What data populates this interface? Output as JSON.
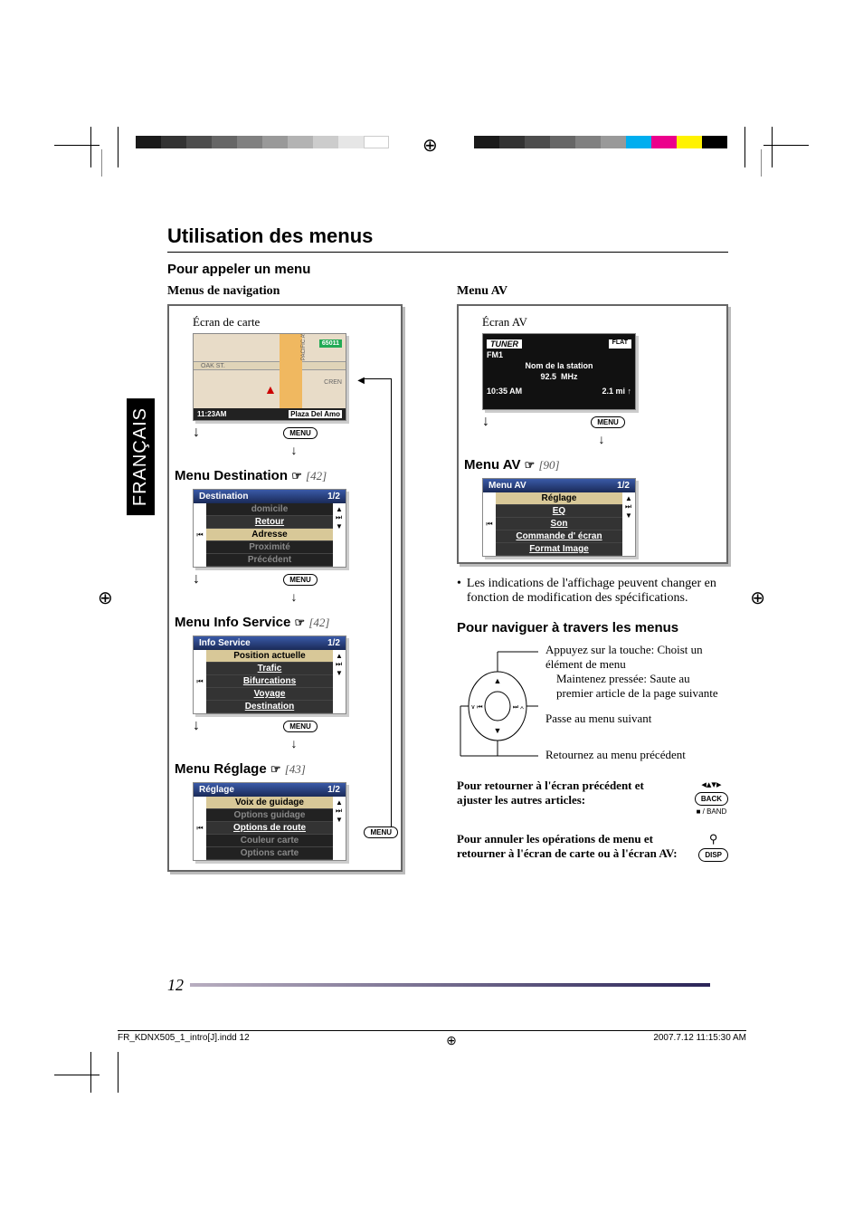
{
  "crop": {
    "grays": [
      "#1a1a1a",
      "#333",
      "#4d4d4d",
      "#666",
      "#808080",
      "#999",
      "#b3b3b3",
      "#ccc",
      "#e6e6e6",
      "#fff"
    ],
    "cmyk": [
      "#00aeef",
      "#ec008c",
      "#fff200",
      "#000"
    ],
    "reg": "⊕"
  },
  "sideTab": "FRANÇAIS",
  "title": "Utilisation des menus",
  "subtitle": "Pour appeler un menu",
  "left": {
    "navMenus": "Menus de navigation",
    "mapScreen": "Écran de carte",
    "map": {
      "streets": [
        "OAK ST.",
        "CREN",
        "PACIFIC AVE",
        "65011"
      ],
      "time": "11:23AM",
      "route": "▲",
      "place": "Plaza Del Amo"
    },
    "menuBtn": "MENU",
    "destTitle": "Menu Destination",
    "destRef": "[42]",
    "destMenu": {
      "header": "Destination",
      "page": "1/2",
      "items": [
        "domicile",
        "Retour",
        "Adresse",
        "Proximité",
        "Précédent"
      ],
      "selected": 2
    },
    "infoTitle": "Menu Info Service",
    "infoRef": "[42]",
    "infoMenu": {
      "header": "Info Service",
      "page": "1/2",
      "items": [
        "Position actuelle",
        "Trafic",
        "Bifurcations",
        "Voyage",
        "Destination"
      ],
      "selected": 0
    },
    "setTitle": "Menu Réglage",
    "setRef": "[43]",
    "setMenu": {
      "header": "Réglage",
      "page": "1/2",
      "items": [
        "Voix de guidage",
        "Options guidage",
        "Options de route",
        "Couleur carte",
        "Options carte"
      ],
      "selected": 0
    }
  },
  "right": {
    "avMenu": "Menu AV",
    "avScreen": "Écran AV",
    "av": {
      "tuner": "TUNER",
      "flat": "FLAT",
      "band": "FM1",
      "station": "Nom de la station",
      "freq": "92.5",
      "unit": "MHz",
      "time": "10:35 AM",
      "dist": "2.1 mi",
      "compass": "↑"
    },
    "avMenuTitle": "Menu AV",
    "avMenuRef": "[90]",
    "avMenuData": {
      "header": "Menu AV",
      "page": "1/2",
      "items": [
        "Réglage",
        "EQ",
        "Son",
        "Commande d' écran",
        "Format Image"
      ],
      "selected": 0
    },
    "bullet": "Les indications de l'affichage peuvent changer en fonction de modification des spécifications.",
    "navHeading": "Pour naviguer à travers les menus",
    "dpad": {
      "up": "Appuyez sur la touche: Choist un élément de menu",
      "hold": "Maintenez pressée: Saute au premier article de la page suivante",
      "right": "Passe au menu suivant",
      "down": "Retournez au menu précédent"
    },
    "back": {
      "text": "Pour retourner à l'écran précédent et ajuster les autres articles:",
      "btn": "BACK",
      "sub": "■ / BAND",
      "arrows": "◂▴▾▸"
    },
    "cancel": {
      "text": "Pour annuler les opérations de menu et retourner à l'écran de carte ou à l'écran AV:",
      "btn": "DISP",
      "icon": "⚲"
    }
  },
  "pageNum": "12",
  "footer": {
    "file": "FR_KDNX505_1_intro[J].indd   12",
    "date": "2007.7.12   11:15:30 AM"
  }
}
